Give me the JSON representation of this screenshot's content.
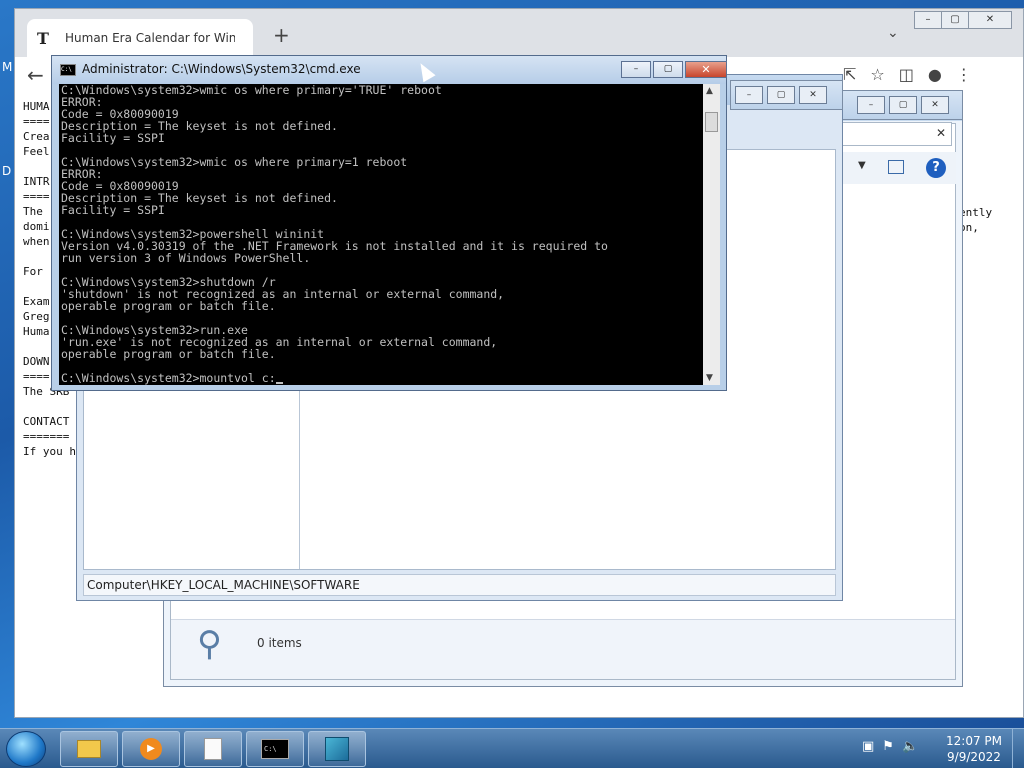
{
  "desktop": {
    "letters": [
      "M",
      "D"
    ]
  },
  "chrome": {
    "tab_title": "Human Era Calendar for Windows",
    "tab_favicon": "T",
    "new_tab": "+",
    "icons": [
      "back-arrow-icon",
      "share-icon",
      "star-icon",
      "sidebar-icon",
      "profile-icon",
      "menu-icon"
    ],
    "content_lines": "HUMA\n====\nCrea\nFeel\n\nINTR\n====\nThe \ndomi\nwhen\n\nFor \n\nExam\nGreg\nHuma\n\nDOWN\n====\nThe SRB\n\nCONTACT\n=======\nIf you h",
    "right_text": "ently\non,"
  },
  "explorer": {
    "items_label": "0 items"
  },
  "regedit": {
    "status_path": "Computer\\HKEY_LOCAL_MACHINE\\SOFTWARE"
  },
  "cmd": {
    "title": "Administrator: C:\\Windows\\System32\\cmd.exe",
    "icon_text": "C:\\",
    "console_lines": [
      "C:\\Windows\\system32>wmic os where primary='TRUE' reboot",
      "ERROR:",
      "Code = 0x80090019",
      "Description = The keyset is not defined.",
      "Facility = SSPI",
      "",
      "C:\\Windows\\system32>wmic os where primary=1 reboot",
      "ERROR:",
      "Code = 0x80090019",
      "Description = The keyset is not defined.",
      "Facility = SSPI",
      "",
      "C:\\Windows\\system32>powershell wininit",
      "Version v4.0.30319 of the .NET Framework is not installed and it is required to",
      "run version 3 of Windows PowerShell.",
      "",
      "C:\\Windows\\system32>shutdown /r",
      "'shutdown' is not recognized as an internal or external command,",
      "operable program or batch file.",
      "",
      "C:\\Windows\\system32>run.exe",
      "'run.exe' is not recognized as an internal or external command,",
      "operable program or batch file.",
      "",
      "C:\\Windows\\system32>mountvol c:"
    ]
  },
  "taskbar": {
    "items": [
      "windows-explorer",
      "media-player",
      "notepad",
      "command-prompt",
      "registry-editor"
    ],
    "clock_time": "12:07 PM",
    "clock_date": "9/9/2022"
  }
}
